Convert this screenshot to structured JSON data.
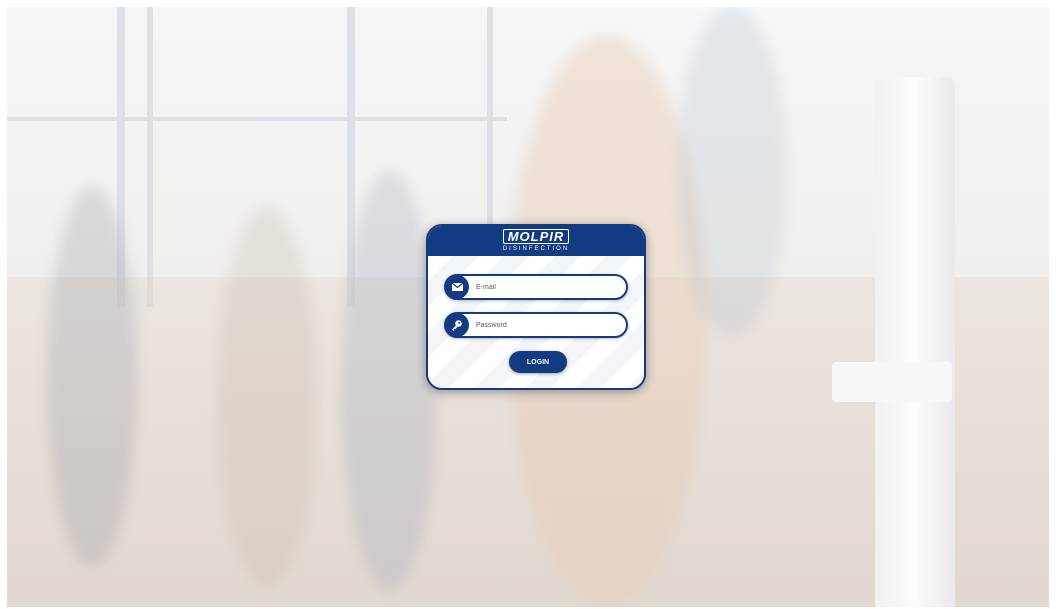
{
  "brand": {
    "name": "MOLPIR",
    "tagline": "DISINFECTION"
  },
  "form": {
    "email": {
      "placeholder": "E-mail",
      "value": "",
      "icon": "envelope-icon"
    },
    "password": {
      "placeholder": "Password",
      "value": "",
      "icon": "key-icon"
    },
    "login_label": "LOGIN"
  },
  "colors": {
    "primary": "#123b82",
    "card_bg": "#ffffff"
  }
}
